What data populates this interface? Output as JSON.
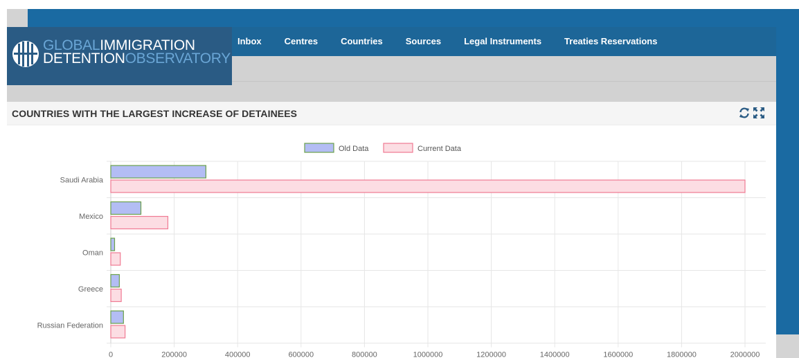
{
  "logo": {
    "line1_a": "GLOBAL",
    "line1_b": "IMMIGRATION",
    "line2_a": "DETENTION",
    "line2_b": "OBSERVATORY",
    "icon": "globe-icon"
  },
  "nav": {
    "items": [
      {
        "label": "Inbox"
      },
      {
        "label": "Centres"
      },
      {
        "label": "Countries"
      },
      {
        "label": "Sources"
      },
      {
        "label": "Legal Instruments"
      },
      {
        "label": "Treaties Reservations"
      }
    ]
  },
  "panel": {
    "title": "COUNTRIES WITH THE LARGEST INCREASE OF DETAINEES",
    "tools": [
      "refresh-icon",
      "fullscreen-icon"
    ]
  },
  "colors": {
    "nav": "#1d6698",
    "logo_bg": "#2a5b84",
    "old_fill": "#b3bdf4",
    "old_border": "#6aa04a",
    "current_fill": "#fcdde3",
    "current_border": "#f07a93"
  },
  "chart_data": {
    "type": "bar",
    "orientation": "horizontal",
    "categories": [
      "Saudi Arabia",
      "Mexico",
      "Oman",
      "Greece",
      "Russian Federation"
    ],
    "series": [
      {
        "name": "Old Data",
        "values": [
          300000,
          95000,
          12000,
          27000,
          40000
        ]
      },
      {
        "name": "Current Data",
        "values": [
          2000000,
          180000,
          30000,
          33000,
          45000
        ]
      }
    ],
    "xlim": [
      0,
      2000000
    ],
    "xticks": [
      "0",
      "200000",
      "400000",
      "600000",
      "800000",
      "1000000",
      "1200000",
      "1400000",
      "1600000",
      "1800000",
      "2000000"
    ],
    "grid": true,
    "legend_position": "top"
  }
}
